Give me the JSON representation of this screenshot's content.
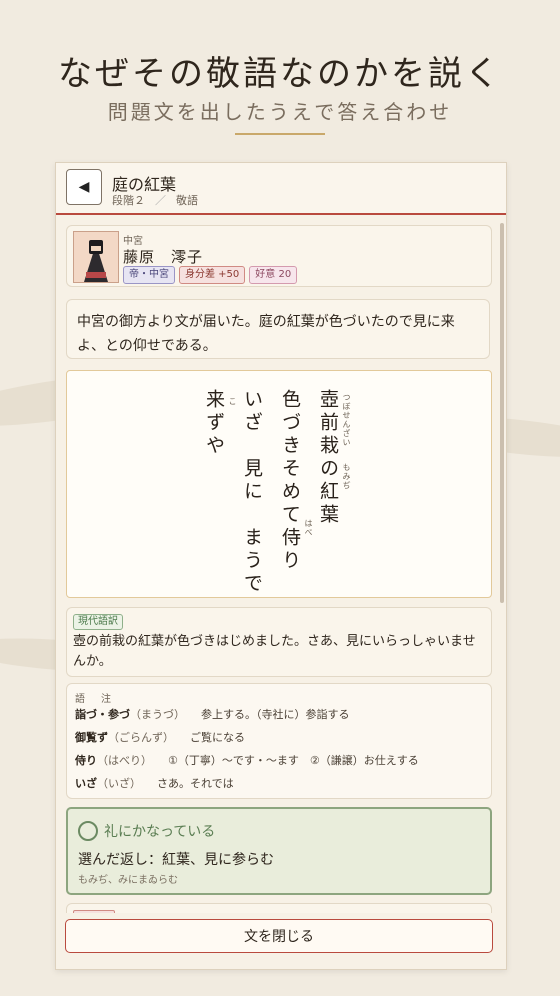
{
  "promo": {
    "title": "なぜその敬語なのかを説く",
    "subtitle": "問題文を出したうえで答え合わせ"
  },
  "header": {
    "back_glyph": "◀",
    "title": "庭の紅葉",
    "stage": "段階２",
    "separator": "／",
    "category": "敬語"
  },
  "character": {
    "role": "中宮",
    "name": "藤原　澪子",
    "tags": [
      "帝・中宮",
      "身分差 +50",
      "好意 20"
    ]
  },
  "message": "中宮の御方より文が届いた。庭の紅葉が色づいたので見に来よ、との仰せである。",
  "poem": {
    "columns": [
      "壺前栽の紅葉",
      "色づきそめて侍り",
      "いざ　見に　まうで",
      "来ずや"
    ],
    "ruby": {
      "tsubosenzai": "つぼせんざい",
      "momiji": "もみぢ",
      "haberi": "はべ",
      "ko": "こ"
    }
  },
  "translation": {
    "label": "現代語訳",
    "text": "壺の前栽の紅葉が色づきはじめました。さあ、見にいらっしゃいませんか。"
  },
  "notes": {
    "title": "語　注",
    "items": [
      {
        "word": "詣づ・参づ",
        "reading": "（まうづ）",
        "meaning": "参上する。（寺社に）参詣する"
      },
      {
        "word": "御覧ず",
        "reading": "（ごらんず）",
        "meaning": "ご覧になる"
      },
      {
        "word": "侍り",
        "reading": "（はべり）",
        "meaning": "①（丁寧）〜です・〜ます　②（謙譲）お仕えする"
      },
      {
        "word": "いざ",
        "reading": "（いざ）",
        "meaning": "さあ。それでは"
      }
    ]
  },
  "answer": {
    "status": "礼にかなっている",
    "choice": "選んだ返し：紅葉、見に参らむ",
    "reading": "もみぢ、みにまゐらむ"
  },
  "footer": {
    "close_label": "文を閉じる"
  }
}
